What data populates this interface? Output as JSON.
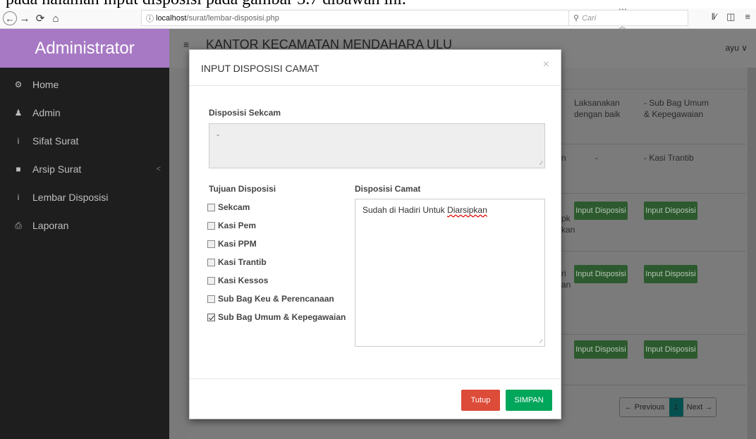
{
  "doc_line": "pada halaman input disposisi pada gambar 3.7 dibawah ini.",
  "browser": {
    "url_host": "localhost",
    "url_path": "/surat/lembar-disposisi.php",
    "search_placeholder": "Cari",
    "actions": "⋯ ▼ ☆"
  },
  "sidebar": {
    "title": "Administrator",
    "items": [
      {
        "label": "Home",
        "icon": "⚙"
      },
      {
        "label": "Admin",
        "icon": "♟"
      },
      {
        "label": "Sifat Surat",
        "icon": "i"
      },
      {
        "label": "Arsip Surat",
        "icon": "■",
        "chevron": "<"
      },
      {
        "label": "Lembar Disposisi",
        "icon": "i"
      },
      {
        "label": "Laporan",
        "icon": "⎙"
      }
    ]
  },
  "header": {
    "office": "KANTOR KECAMATAN MENDAHARA ULU",
    "user": "ayu ∨"
  },
  "background": {
    "row1_col1": "Laksanakan dengan baik",
    "row1_col2": "- Sub Bag Umum & Kepegawaian",
    "row2_col1": "-",
    "row2_col2": "- Kasi Trantib",
    "row2_left": "n",
    "row3_left": "pk kan",
    "row4_left": "ri an",
    "button_label": "Input Disposisi",
    "pager": {
      "prev": "← Previous",
      "current": "1",
      "next": "Next →"
    }
  },
  "modal": {
    "title": "INPUT DISPOSISI CAMAT",
    "close": "×",
    "sekcam_label": "Disposisi Sekcam",
    "sekcam_value": "-",
    "tujuan_label": "Tujuan Disposisi",
    "camat_label": "Disposisi Camat",
    "camat_text_a": "Sudah di Hadiri Untuk ",
    "camat_text_b": "Diarsipkan",
    "options": [
      {
        "label": "Sekcam",
        "checked": false
      },
      {
        "label": "Kasi Pem",
        "checked": false
      },
      {
        "label": "Kasi PPM",
        "checked": false
      },
      {
        "label": "Kasi Trantib",
        "checked": false
      },
      {
        "label": "Kasi Kessos",
        "checked": false
      },
      {
        "label": "Sub Bag Keu & Perencanaan",
        "checked": false
      },
      {
        "label": "Sub Bag Umum & Kepegawaian",
        "checked": true
      }
    ],
    "btn_close": "Tutup",
    "btn_save": "SIMPAN"
  }
}
